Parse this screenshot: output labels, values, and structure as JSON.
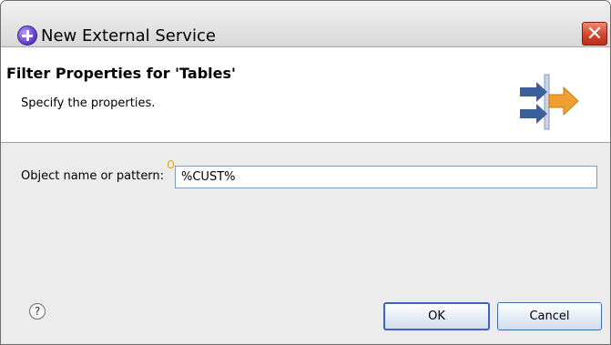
{
  "window": {
    "title": "New External Service",
    "close_label": "✕"
  },
  "header": {
    "title": "Filter Properties for 'Tables'",
    "description": "Specify the properties."
  },
  "form": {
    "object_name_label": "Object name or pattern:",
    "object_name_value": "%CUST%"
  },
  "footer": {
    "help_symbol": "?",
    "ok_label": "OK",
    "cancel_label": "Cancel"
  },
  "icons": {
    "app": "wizard-app-icon",
    "help": "help-icon",
    "wizard_graphic": "external-service-arrows-icon",
    "required_marker": "content-assist-marker-icon"
  },
  "colors": {
    "close_button": "#d2452a",
    "button_border": "#3c6aa8",
    "arrow_blue": "#3b5f9a",
    "arrow_orange": "#f0a030"
  }
}
